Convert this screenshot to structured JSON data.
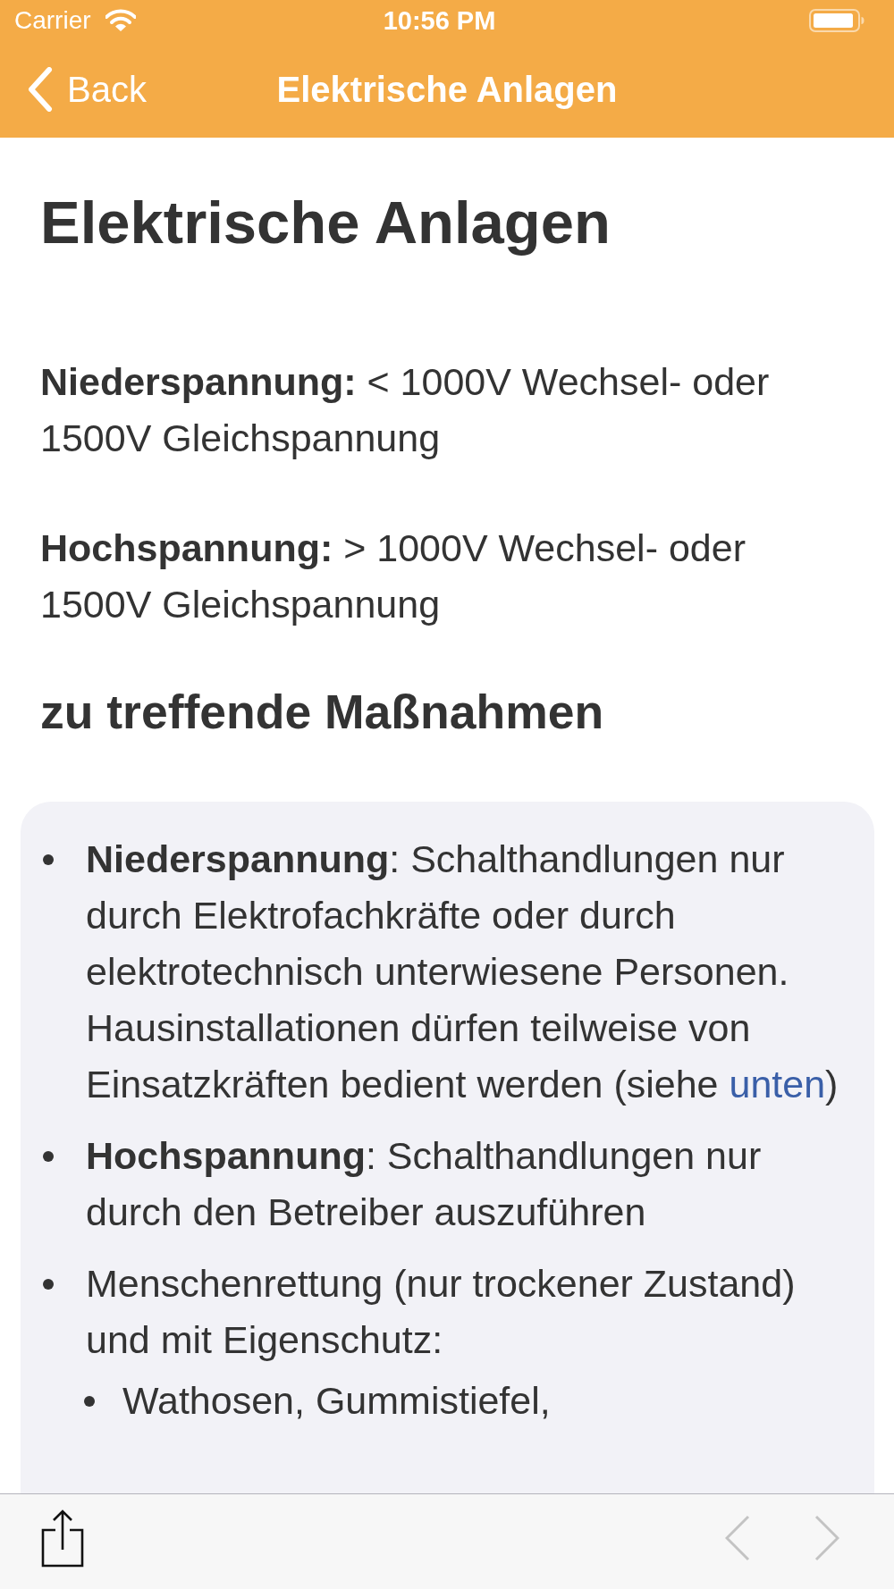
{
  "status_bar": {
    "carrier": "Carrier",
    "time": "10:56 PM"
  },
  "nav_bar": {
    "back": "Back",
    "title": "Elektrische Anlagen"
  },
  "article": {
    "title": "Elektrische Anlagen",
    "paragraphs": [
      "**Niederspannung:** < 1000V Wechsel- oder 1500V Gleichspannung",
      "**Hochspannung:** > 1000V Wechsel- oder 1500V Gleichspannung"
    ],
    "section_heading": "zu treffende Maßnahmen",
    "list": [
      {
        "text": "**Niederspannung**: Schalthandlungen nur durch Elektrofachkräfte oder durch elektrotechnisch unterwiesene Personen. Hausinstallationen dürfen teilweise von Einsatzkräften bedient werden (siehe ",
        "link": "unten",
        "after": ")"
      },
      {
        "text": "**Hochspannung**: Schalthandlungen nur durch den Betreiber auszuführen"
      },
      {
        "text": "Menschenrettung (nur trockener Zustand) und mit Eigenschutz:",
        "children": [
          {
            "text": "Wathosen, Gummistiefel,"
          }
        ]
      }
    ]
  },
  "toolbar": [
    {
      "kind": "share",
      "disabled": false
    },
    {
      "kind": "previous",
      "disabled": true
    },
    {
      "kind": "next",
      "disabled": true
    }
  ]
}
